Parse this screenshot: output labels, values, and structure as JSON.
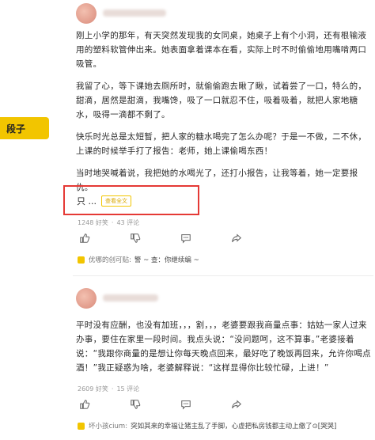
{
  "sidebar": {
    "active_label": "段子"
  },
  "post1": {
    "paragraphs": [
      "刚上小学的那年，有天突然发现我的女同桌，她桌子上有个小洞，还有根输液用的塑料软管伸出来。她表面拿着课本在看，实际上时不时偷偷地用嘴啃两口吸管。",
      "我留了心，等下课她去厕所时，就偷偷跑去瞅了瞅，试着尝了一口，特么的，甜滴，居然是甜滴，我嘴馋，吸了一口就忍不住，吸着吸着，就把人家地糖水，吸得一滴都不剩了。",
      "快乐时光总是太短暂，把人家的糖水喝完了怎么办呢？于是一不做，二不休，上课的时候举手打了报告：老师，她上课偷喝东西！",
      "当时地哭喊着说，我把她的水喝光了，还打小报告，让我等着，她一定要报仇。"
    ],
    "truncated_text": "只 ...",
    "read_more_label": "查看全文",
    "likes": "1248 好笑",
    "comments": "43 评论",
    "hot_comment_user": "优哪的创可贴:",
    "hot_comment_text": "警 ~ 查：你继续编 ~"
  },
  "post2": {
    "paragraph": "平时没有应酬，也没有加班，，，割，，，老婆要跟我商量点事：姑姑一家人过来办事，要住在家里一段时间。我点头说：“没问题呵，这不算事。”老婆接着说：“我跟你商量的是想让你每天晚点回来，最好吃了晚饭再回来，允许你喝点酒！”我正疑惑为啥，老婆解释说：“这样显得你比较忙碌，上进！”",
    "likes": "2609 好笑",
    "comments": "15 评论",
    "hot_comment_user": "坏小孩cium:",
    "hot_comment_text": "突如其来的幸福让猪主乱了手脚，心虚把私房钱都主动上缴了⊙[哭哭]"
  },
  "icons": {
    "like": "thumbs-up-icon",
    "dislike": "thumbs-down-icon",
    "comment": "comment-bubble-icon",
    "share": "share-icon",
    "hot_comment": "hot-comment-icon"
  },
  "colors": {
    "accent": "#f2c500",
    "highlight_box": "#e53935",
    "stats_gray": "#999999"
  }
}
